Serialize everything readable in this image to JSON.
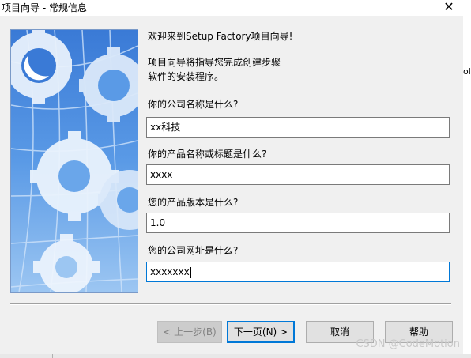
{
  "window": {
    "title": "项目向导 - 常规信息",
    "close_glyph": "✕",
    "background_fragment": "ol"
  },
  "intro": {
    "welcome": "欢迎来到Setup Factory项目向导!",
    "line1": "项目向导将指导您完成创建步骤",
    "line2": "软件的安装程序。"
  },
  "form": {
    "company_label": "你的公司名称是什么?",
    "company_value": "xx科技",
    "product_label": "你的产品名称或标题是什么?",
    "product_value": "xxxx",
    "version_label": "您的产品版本是什么?",
    "version_value": "1.0",
    "website_label": "您的公司网址是什么?",
    "website_value": "xxxxxxx"
  },
  "buttons": {
    "back": "< 上一步(B)",
    "next": "下一页(N) >",
    "cancel": "取消",
    "help": "帮助"
  },
  "watermark": "CSDN @CodeMotion",
  "colors": {
    "accent": "#0078d7",
    "graphic_bg": "#4f8fe0",
    "gear": "#e6f0fb"
  }
}
